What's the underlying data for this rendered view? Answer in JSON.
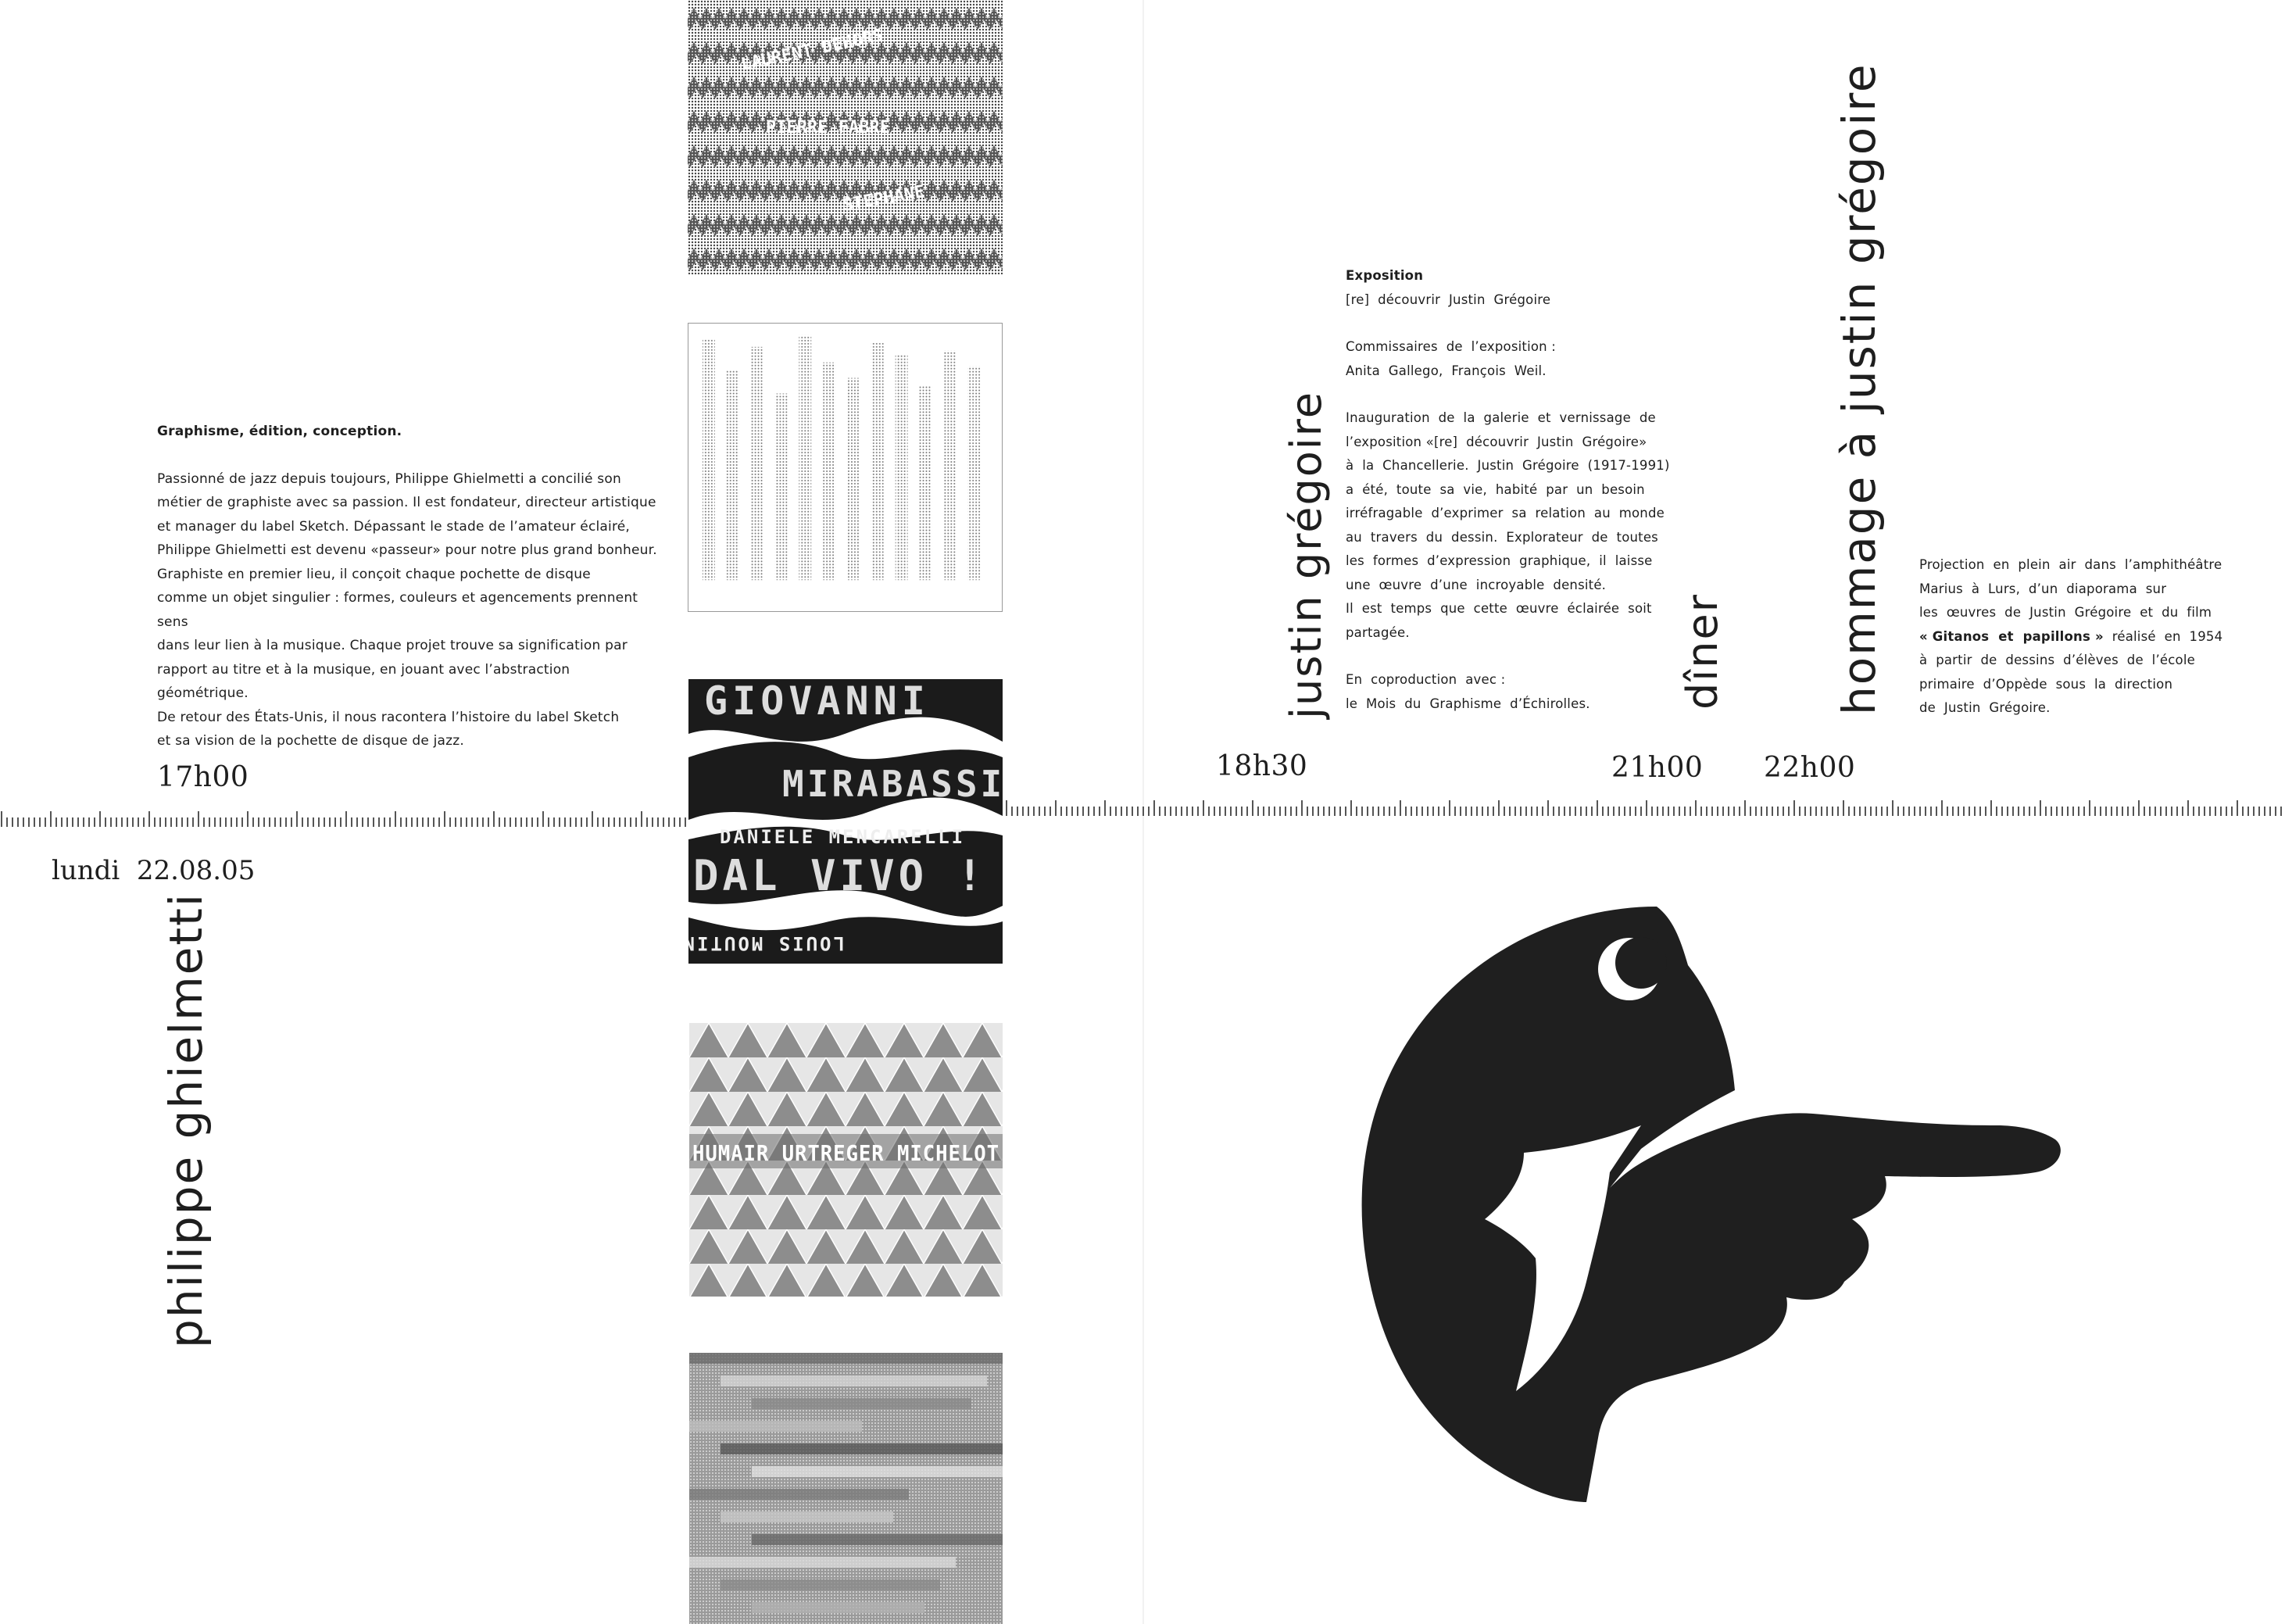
{
  "left_page": {
    "intro": {
      "heading": "Graphisme, édition, conception.",
      "lines": [
        "Passionné de jazz depuis toujours, Philippe Ghielmetti a concilié son",
        "métier de graphiste avec sa passion. Il est fondateur, directeur artistique",
        "et manager du label Sketch. Dépassant le stade de l’amateur éclairé,",
        "Philippe Ghielmetti est devenu «passeur» pour notre plus grand bonheur.",
        "Graphiste en premier lieu, il conçoit chaque pochette de disque",
        "comme un objet singulier : formes, couleurs et agencements prennent sens",
        "dans leur lien à la musique. Chaque projet trouve sa signification par",
        "rapport au titre et à la musique, en jouant avec l’abstraction géométrique.",
        "De retour des États-Unis, il nous racontera l’histoire du label Sketch",
        "et sa vision de la pochette de disque de jazz."
      ]
    },
    "time": "17h00",
    "date": "lundi  22.08.05",
    "speaker": "philippe  ghielmetti",
    "covers": {
      "cover1_lines": [
        "LAURENT  DEHORS",
        "PIERRE  FABRE",
        "STEPHANE"
      ],
      "cover3_lines": [
        "GIOVANNI",
        "MIRABASSI",
        "DANIELE MENCARELLI",
        "DAL VIVO !",
        "LOUIS MOUTIN"
      ],
      "cover4_line": "HUMAIR URTREGER MICHELOT"
    }
  },
  "right_page": {
    "expo": {
      "heading": "Exposition",
      "lines": [
        "[re]  découvrir  Justin  Grégoire",
        "",
        "Commissaires  de  l’exposition :",
        "Anita  Gallego,  François  Weil.",
        "",
        "Inauguration  de  la  galerie  et  vernissage  de",
        "l’exposition «[re]  découvrir  Justin  Grégoire»",
        "à  la  Chancellerie.  Justin  Grégoire  (1917-1991)",
        "a  été,  toute  sa  vie,  habité  par  un  besoin",
        "irréfragable  d’exprimer  sa  relation  au  monde",
        "au  travers  du  dessin.  Explorateur  de  toutes",
        "les  formes  d’expression  graphique,  il  laisse",
        "une  œuvre  d’une  incroyable  densité.",
        "Il  est  temps  que  cette  œuvre  éclairée  soit",
        "partagée.",
        "",
        "En  coproduction  avec :",
        "le  Mois  du  Graphisme  d’Échirolles."
      ]
    },
    "rotated_titles": {
      "justin": "justin  grégoire",
      "diner": "dîner",
      "hommage": "hommage  à  justin  grégoire"
    },
    "projection": {
      "line1": "Projection  en  plein  air  dans  l’amphithéâtre",
      "line2": "Marius  à  Lurs,  d’un  diaporama  sur",
      "line3": "les  œuvres  de  Justin  Grégoire  et  du  film",
      "line4_bold": "« Gitanos  et  papillons »",
      "line4_rest": "  réalisé  en  1954",
      "line5": "à  partir  de  dessins  d’élèves  de  l’école",
      "line6": "primaire  d’Oppède  sous  la  direction",
      "line7": "de  Justin  Grégoire."
    },
    "times": {
      "t1": "18h30",
      "t2": "21h00",
      "t3": "22h00"
    },
    "illustration": "bird-hand-icon"
  }
}
